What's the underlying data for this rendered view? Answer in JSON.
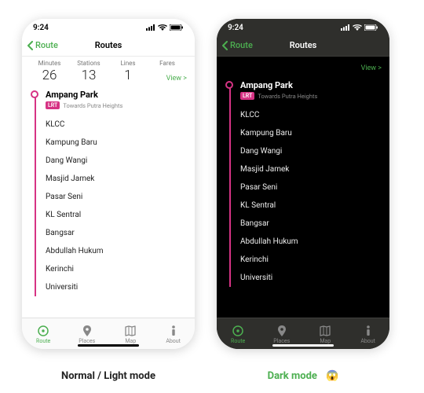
{
  "status": {
    "time": "9:24"
  },
  "nav": {
    "back": "Route",
    "title": "Routes"
  },
  "summary": {
    "cols": [
      {
        "label": "Minutes",
        "value": "26"
      },
      {
        "label": "Stations",
        "value": "13"
      },
      {
        "label": "Lines",
        "value": "1"
      },
      {
        "label": "Fares",
        "value": ""
      }
    ],
    "view": "View >"
  },
  "route": {
    "origin": {
      "name": "Ampang Park",
      "badge": "LRT",
      "towards": "Towards Putra Heights"
    },
    "stops": [
      "KLCC",
      "Kampung Baru",
      "Dang Wangi",
      "Masjid Jamek",
      "Pasar Seni",
      "KL Sentral",
      "Bangsar",
      "Abdullah Hukum",
      "Kerinchi",
      "Universiti"
    ]
  },
  "tabs": [
    {
      "label": "Route"
    },
    {
      "label": "Places"
    },
    {
      "label": "Map"
    },
    {
      "label": "About"
    }
  ],
  "captions": {
    "light": "Normal / Light mode",
    "dark": "Dark mode",
    "emoji": "😱"
  },
  "colors": {
    "accent": "#4caf50",
    "line": "#d63384"
  }
}
